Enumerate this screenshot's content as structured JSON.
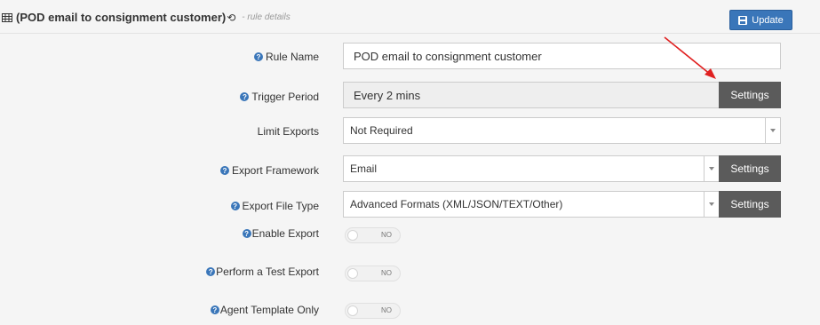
{
  "header": {
    "title": "(POD email to consignment customer)",
    "subtitle": "- rule details",
    "update_label": "Update"
  },
  "form": {
    "rule_name": {
      "label": "Rule Name",
      "value": "POD email to consignment customer"
    },
    "trigger_period": {
      "label": "Trigger Period",
      "value": "Every 2 mins",
      "button": "Settings"
    },
    "limit_exports": {
      "label": "Limit Exports",
      "value": "Not Required"
    },
    "export_framework": {
      "label": "Export Framework",
      "value": "Email",
      "button": "Settings"
    },
    "export_file_type": {
      "label": "Export File Type",
      "value": "Advanced Formats (XML/JSON/TEXT/Other)",
      "button": "Settings"
    },
    "enable_export": {
      "label": "Enable Export",
      "toggle": "NO"
    },
    "test_export": {
      "label": "Perform a Test Export",
      "toggle": "NO"
    },
    "agent_template": {
      "label": "Agent Template Only",
      "toggle": "NO"
    }
  },
  "colors": {
    "primary": "#3a76b9",
    "settings_bg": "#5b5b5b",
    "annotation_arrow": "#e02020"
  },
  "icons": [
    "table-icon",
    "history-icon",
    "save-icon",
    "question-circle-icon",
    "chevron-down-icon",
    "annotation-arrow"
  ]
}
